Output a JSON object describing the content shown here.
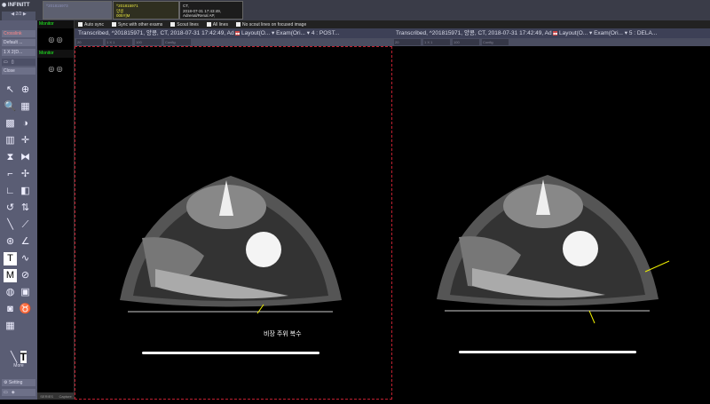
{
  "app": {
    "logo": "INFINITT",
    "pager": "2/2"
  },
  "tabs": [
    {
      "id": "^201815973",
      "name": "",
      "extra": ""
    },
    {
      "id": "^201815971",
      "name": "양콩",
      "extra": "005Y|M"
    },
    {
      "id": "CT,",
      "name": "2018-07-31 17:43:49,",
      "extra": "Adrenal/Renal AP,"
    }
  ],
  "left": {
    "crosslink": "Crosslink",
    "layout1": "Default ...",
    "layout2": "1 X 2(D...",
    "close": "Close",
    "more": "More",
    "setting": "Setting"
  },
  "tools": [
    "arrow",
    "zoom",
    "magnifier",
    "window",
    "invert-box",
    "contrast",
    "ruler-box",
    "crosshair",
    "flip-v",
    "flip-h",
    "crop",
    "pan",
    "rotate-left",
    "rotate-right",
    "reset",
    "rotate",
    "line",
    "measure",
    "roi",
    "angle",
    "text",
    "freehand",
    "marker",
    "circle",
    "save-key",
    "save",
    "capture",
    "lungs",
    "grid"
  ],
  "thumbs": {
    "monitor1": "Monitor",
    "monitor2": "Monitor",
    "series": "SERIES",
    "capture": "Capture"
  },
  "sync": {
    "auto_sync": "Auto sync",
    "sync_other": "Sync with other exams",
    "scout": "Scout lines",
    "all_lines": "All lines",
    "no_scout": "No scout lines on focused image"
  },
  "viewports": [
    {
      "info": "Transcribed, ^201815971, 양콩, CT, 2018-07-31 17:42:49, Ad",
      "layout": "Layout(O...",
      "exam": "Exam(Ori...",
      "series": "4 : POST...",
      "fields": [
        "20",
        "1 X 1",
        "100",
        "Config"
      ],
      "annotation": "비장 주위 복수"
    },
    {
      "info": "Transcribed, ^201815971, 양콩, CT, 2018-07-31 17:42:49, Ad",
      "layout": "Layout(O...",
      "exam": "Exam(Ori...",
      "series": "5 : DELA...",
      "fields": [
        "20",
        "1 X 1",
        "100",
        "Config"
      ]
    }
  ]
}
